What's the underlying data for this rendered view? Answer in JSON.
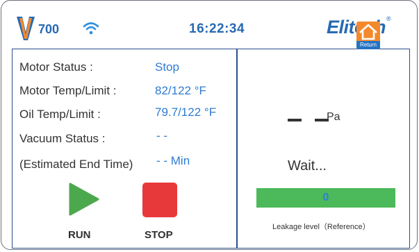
{
  "header": {
    "model": "700",
    "time": "16:22:34",
    "brand": "Elitech",
    "brand_mark": "®"
  },
  "status": {
    "rows": [
      {
        "label": "Motor Status :",
        "value": "Stop"
      },
      {
        "label": "Motor Temp/Limit :",
        "value": "82/122 °F"
      },
      {
        "label": "Oil Temp/Limit :",
        "value": "79.7/122 °F"
      },
      {
        "label": "Vacuum Status :",
        "value": "- -"
      },
      {
        "label": "(Estimated End Time)",
        "value": "- - Min"
      }
    ]
  },
  "controls": {
    "run_label": "RUN",
    "stop_label": "STOP"
  },
  "pressure": {
    "unit": "Pa",
    "message": "Wait...",
    "leakage_value": "0",
    "leakage_label": "Leakage level（Reference）"
  },
  "return_button": {
    "label": "Return"
  },
  "colors": {
    "accent": "#2769b3",
    "value_text": "#2d7bd0",
    "run": "#4ca84d",
    "stop": "#e8393a",
    "leak_bar": "#4cb95a",
    "return_bg": "#f3892b"
  }
}
